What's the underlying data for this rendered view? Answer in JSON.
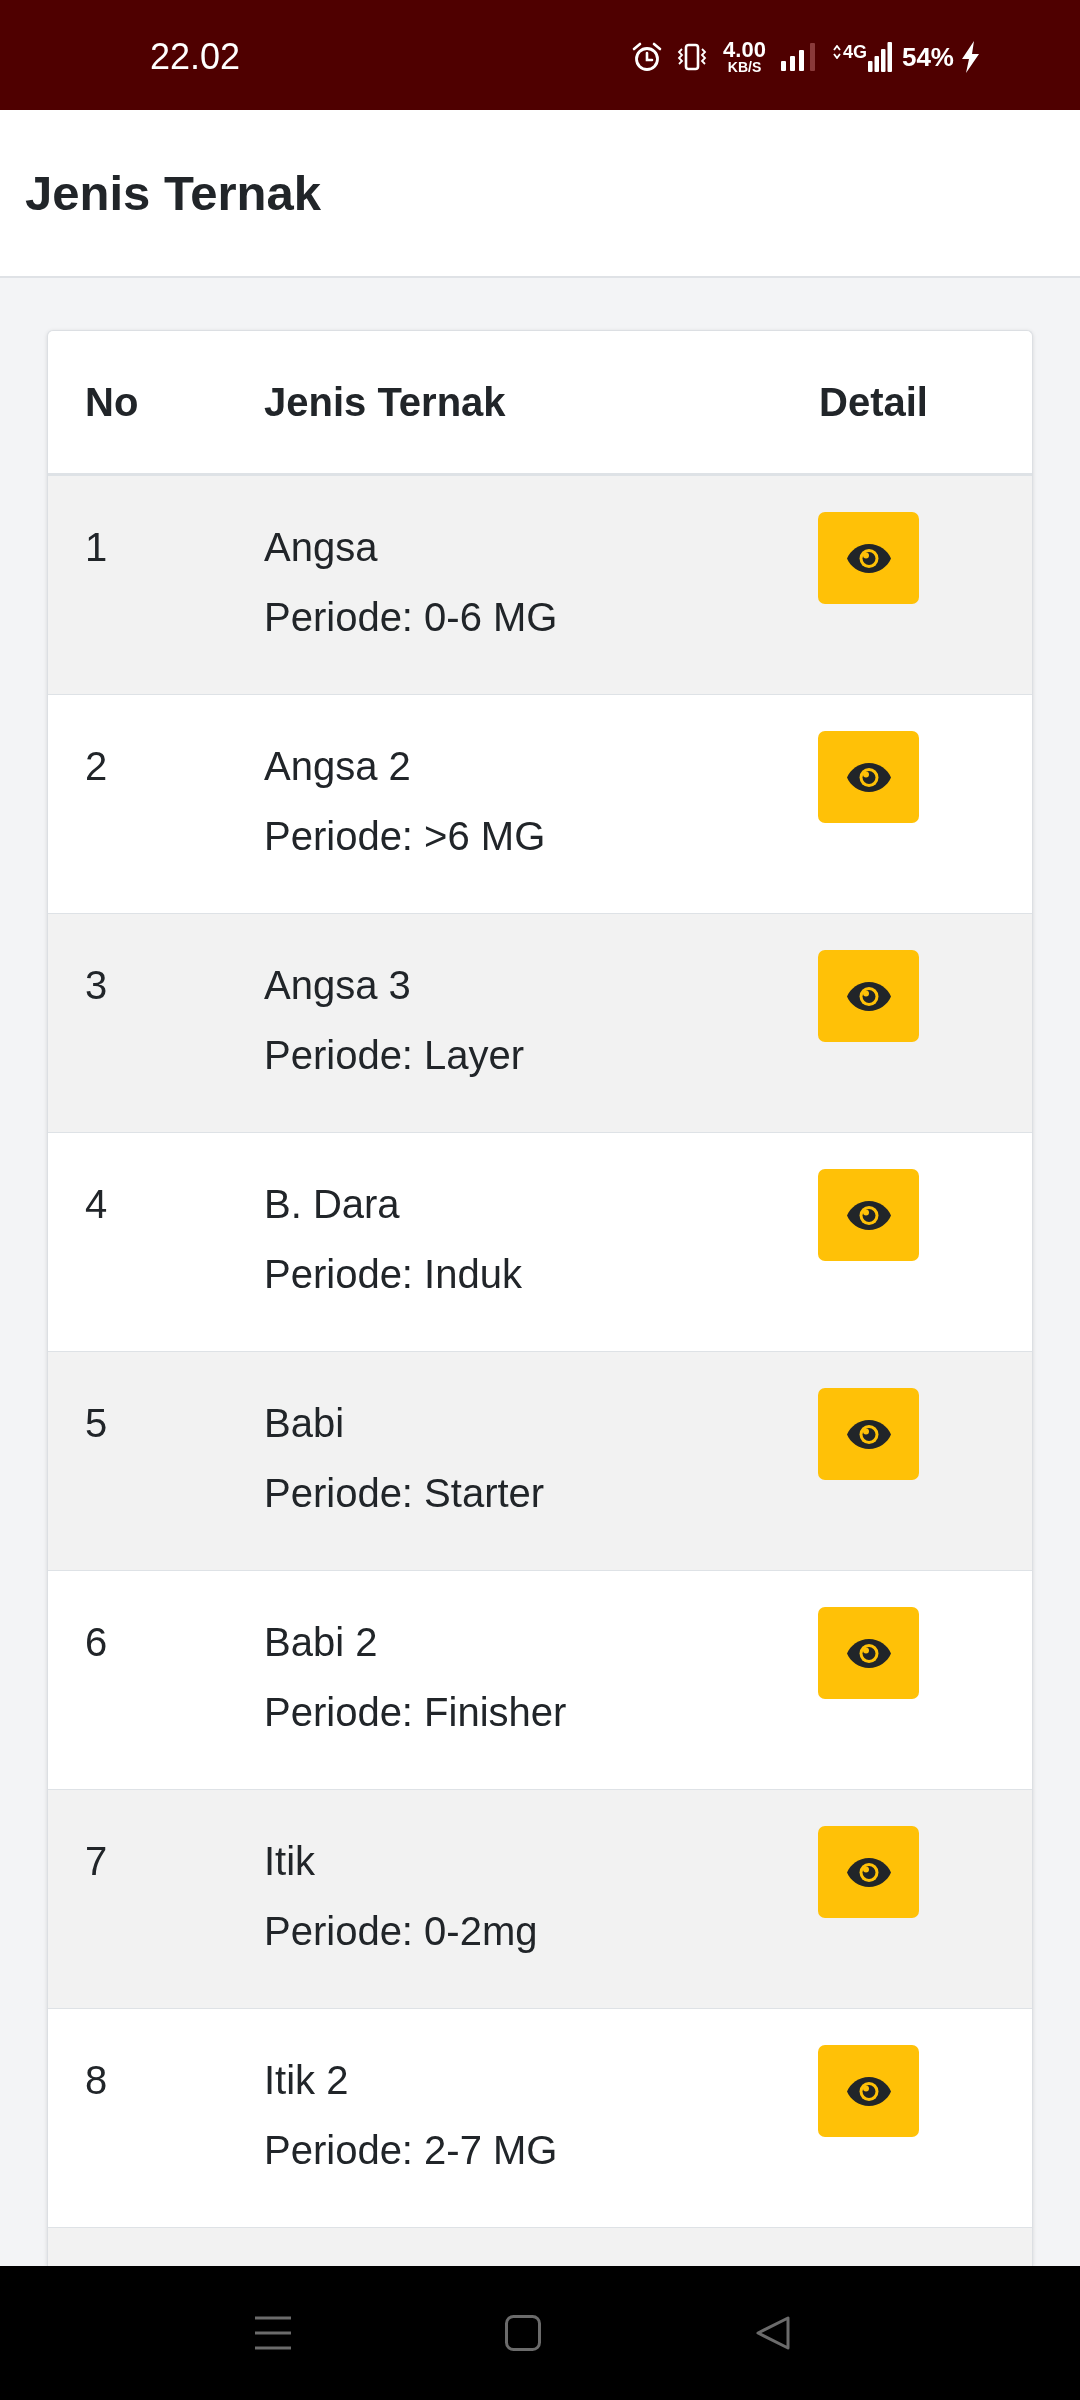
{
  "status_bar": {
    "time": "22.02",
    "data_speed": "4.00",
    "data_speed_unit": "KB/S",
    "network_type": "4G",
    "battery": "54%"
  },
  "app_bar": {
    "title": "Jenis Ternak"
  },
  "table": {
    "columns": [
      "No",
      "Jenis Ternak",
      "Detail"
    ],
    "rows": [
      {
        "no": "1",
        "name": "Angsa",
        "period": "Periode: 0-6 MG"
      },
      {
        "no": "2",
        "name": "Angsa 2",
        "period": "Periode: >6 MG"
      },
      {
        "no": "3",
        "name": "Angsa 3",
        "period": "Periode: Layer"
      },
      {
        "no": "4",
        "name": "B. Dara",
        "period": "Periode: Induk"
      },
      {
        "no": "5",
        "name": "Babi",
        "period": "Periode: Starter"
      },
      {
        "no": "6",
        "name": "Babi 2",
        "period": "Periode: Finisher"
      },
      {
        "no": "7",
        "name": "Itik",
        "period": "Periode: 0-2mg"
      },
      {
        "no": "8",
        "name": "Itik 2",
        "period": "Periode: 2-7 MG"
      }
    ]
  }
}
